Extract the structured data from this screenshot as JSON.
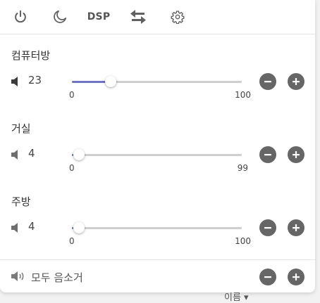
{
  "toolbar": {
    "dsp_label": "DSP",
    "icons": [
      "power-icon",
      "moon-icon",
      "dsp-button",
      "swap-arrows-icon",
      "gear-icon"
    ]
  },
  "zones": [
    {
      "name": "컴퓨터방",
      "volume": "23",
      "min": "0",
      "max": "100",
      "level": 0.23,
      "speaker": "speaker-icon"
    },
    {
      "name": "거실",
      "volume": "4",
      "min": "0",
      "max": "99",
      "level": 0.0404,
      "speaker": "speaker-icon"
    },
    {
      "name": "주방",
      "volume": "4",
      "min": "0",
      "max": "100",
      "level": 0.04,
      "speaker": "speaker-icon"
    }
  ],
  "footer": {
    "label": "모두 음소거"
  },
  "behind_text": "이름 ▾",
  "colors": {
    "slider_fill": "#6f73c4",
    "button_bg": "#666666"
  }
}
